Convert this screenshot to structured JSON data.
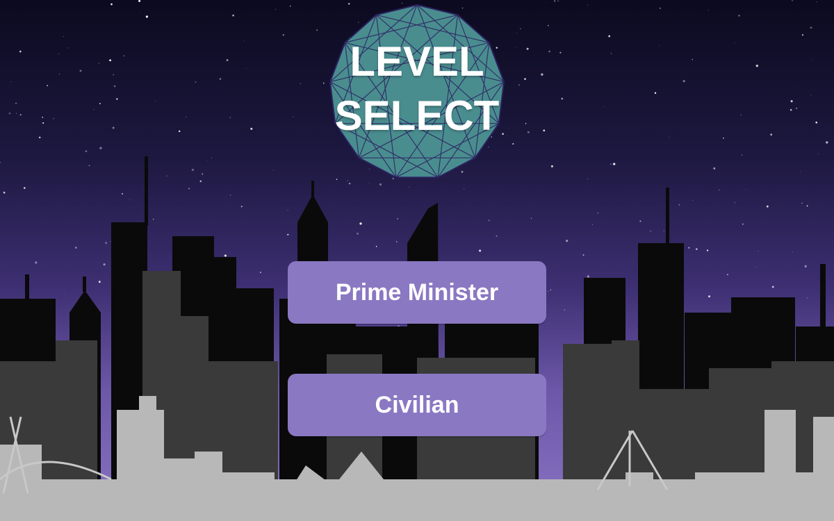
{
  "title": {
    "line1": "LEVEL",
    "line2": "SELECT"
  },
  "levels": [
    {
      "label": "Prime Minister"
    },
    {
      "label": "Civilian"
    }
  ],
  "colors": {
    "button": "#8a78c2",
    "badge": "#4a8d8f",
    "badge_lines": "#2b2260",
    "sky_top": "#0c0a1f",
    "sky_bottom": "#8a74c4"
  }
}
